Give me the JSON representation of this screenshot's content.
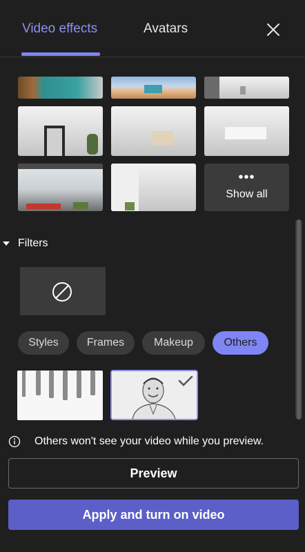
{
  "header": {
    "tabs": [
      {
        "label": "Video effects",
        "active": true
      },
      {
        "label": "Avatars",
        "active": false
      }
    ],
    "close_icon": "close-icon"
  },
  "backgrounds": {
    "show_all_label": "Show all",
    "show_all_icon": "more-dots-icon"
  },
  "filters": {
    "title": "Filters",
    "none_icon": "no-filter-icon",
    "chips": [
      {
        "label": "Styles",
        "active": false
      },
      {
        "label": "Frames",
        "active": false
      },
      {
        "label": "Makeup",
        "active": false
      },
      {
        "label": "Others",
        "active": true
      }
    ],
    "selected_check_icon": "checkmark-icon"
  },
  "info": {
    "icon": "info-icon",
    "text": "Others won't see your video while you preview."
  },
  "actions": {
    "preview_label": "Preview",
    "apply_label": "Apply and turn on video"
  },
  "colors": {
    "accent": "#7f85f5",
    "primary_button": "#5b5fc7",
    "panel_bg": "#1f1f1f"
  }
}
